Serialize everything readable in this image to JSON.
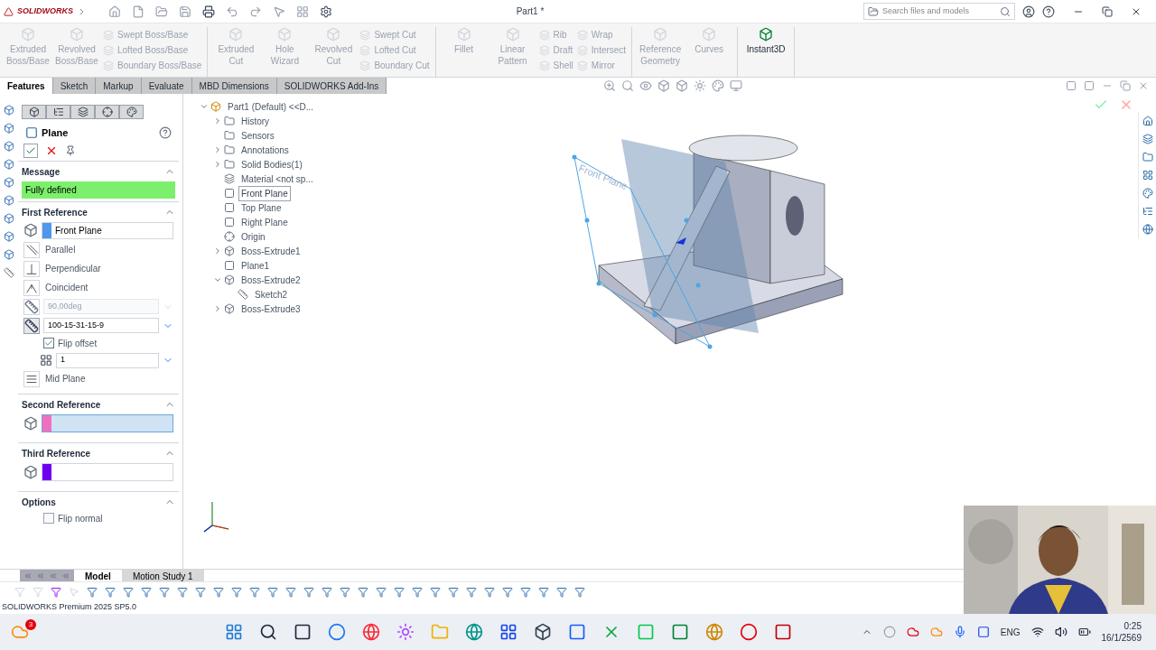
{
  "title_bar": {
    "logo": "SOLIDWORKS",
    "title": "Part1 *",
    "search": {
      "placeholder": "Search files and models"
    }
  },
  "ribbon": {
    "groups": [
      {
        "columns": [
          {
            "kind": "large",
            "items": [
              {
                "label": "Extruded Boss/Base",
                "disabled": true
              }
            ]
          },
          {
            "kind": "large",
            "items": [
              {
                "label": "Revolved Boss/Base",
                "disabled": true
              }
            ]
          },
          {
            "kind": "stack",
            "items": [
              {
                "label": "Swept Boss/Base",
                "disabled": true
              },
              {
                "label": "Lofted Boss/Base",
                "disabled": true
              },
              {
                "label": "Boundary Boss/Base",
                "disabled": true
              }
            ]
          }
        ]
      },
      {
        "columns": [
          {
            "kind": "large",
            "items": [
              {
                "label": "Extruded Cut",
                "disabled": true
              }
            ]
          },
          {
            "kind": "large",
            "items": [
              {
                "label": "Hole Wizard",
                "disabled": true
              }
            ]
          },
          {
            "kind": "large",
            "items": [
              {
                "label": "Revolved Cut",
                "disabled": true
              }
            ]
          },
          {
            "kind": "stack",
            "items": [
              {
                "label": "Swept Cut",
                "disabled": true
              },
              {
                "label": "Lofted Cut",
                "disabled": true
              },
              {
                "label": "Boundary Cut",
                "disabled": true
              }
            ]
          }
        ]
      },
      {
        "columns": [
          {
            "kind": "large",
            "items": [
              {
                "label": "Fillet",
                "disabled": true
              }
            ]
          },
          {
            "kind": "large",
            "items": [
              {
                "label": "Linear Pattern",
                "disabled": true
              }
            ]
          },
          {
            "kind": "stack",
            "items": [
              {
                "label": "Rib",
                "disabled": true
              },
              {
                "label": "Draft",
                "disabled": true
              },
              {
                "label": "Shell",
                "disabled": true
              }
            ]
          },
          {
            "kind": "stack",
            "items": [
              {
                "label": "Wrap",
                "disabled": true
              },
              {
                "label": "Intersect",
                "disabled": true
              },
              {
                "label": "Mirror",
                "disabled": true
              }
            ]
          }
        ]
      },
      {
        "columns": [
          {
            "kind": "large",
            "items": [
              {
                "label": "Reference Geometry",
                "disabled": true
              }
            ]
          },
          {
            "kind": "large",
            "items": [
              {
                "label": "Curves",
                "disabled": true
              }
            ]
          }
        ]
      },
      {
        "columns": [
          {
            "kind": "large",
            "items": [
              {
                "label": "Instant3D",
                "disabled": false
              }
            ]
          }
        ]
      }
    ]
  },
  "command_tabs": [
    {
      "label": "Features",
      "selected": true
    },
    {
      "label": "Sketch",
      "selected": false
    },
    {
      "label": "Markup",
      "selected": false
    },
    {
      "label": "Evaluate",
      "selected": false
    },
    {
      "label": "MBD Dimensions",
      "selected": false
    },
    {
      "label": "SOLIDWORKS Add-Ins",
      "selected": false
    }
  ],
  "property_manager": {
    "title": "Plane",
    "message": {
      "title": "Message",
      "text": "Fully defined"
    },
    "first_reference": {
      "title": "First Reference",
      "value": "Front Plane",
      "color": "#4f97ee",
      "constraints": [
        {
          "kind": "parallel",
          "label": "Parallel"
        },
        {
          "kind": "perpendicular",
          "label": "Perpendicular"
        },
        {
          "kind": "coincident",
          "label": "Coincident"
        }
      ],
      "angle": {
        "value": "90,00deg",
        "disabled": true
      },
      "offset": {
        "value": "100-15-31-15-9"
      },
      "flip_offset": {
        "label": "Flip offset",
        "checked": true
      },
      "count": {
        "value": "1"
      },
      "mid_plane": "Mid Plane"
    },
    "second_reference": {
      "title": "Second Reference",
      "color": "#f070c0",
      "active": true
    },
    "third_reference": {
      "title": "Third Reference",
      "color": "#7000f0",
      "active": false
    },
    "options": {
      "title": "Options",
      "flip_normal": {
        "label": "Flip normal",
        "checked": false
      }
    }
  },
  "feature_tree": [
    {
      "label": "Part1 (Default) <<D...",
      "kind": "part",
      "expanded": true,
      "selected": false,
      "children": [
        {
          "label": "History",
          "kind": "folder",
          "expanded": false,
          "selected": false
        },
        {
          "label": "Sensors",
          "kind": "folder",
          "selected": false
        },
        {
          "label": "Annotations",
          "kind": "folder",
          "expanded": false,
          "selected": false
        },
        {
          "label": "Solid Bodies(1)",
          "kind": "folder",
          "expanded": false,
          "selected": false
        },
        {
          "label": "Material <not sp...",
          "kind": "material",
          "selected": false
        },
        {
          "label": "Front Plane",
          "kind": "plane",
          "selected": true
        },
        {
          "label": "Top Plane",
          "kind": "plane",
          "selected": false
        },
        {
          "label": "Right Plane",
          "kind": "plane",
          "selected": false
        },
        {
          "label": "Origin",
          "kind": "origin",
          "selected": false
        },
        {
          "label": "Boss-Extrude1",
          "kind": "feature",
          "expanded": false,
          "selected": false
        },
        {
          "label": "Plane1",
          "kind": "plane",
          "selected": false
        },
        {
          "label": "Boss-Extrude2",
          "kind": "feature",
          "expanded": true,
          "selected": false,
          "children": [
            {
              "label": "Sketch2",
              "kind": "sketch",
              "selected": false
            }
          ]
        },
        {
          "label": "Boss-Extrude3",
          "kind": "feature",
          "expanded": false,
          "selected": false
        }
      ]
    }
  ],
  "graphics": {
    "plane_label": "Front Plane"
  },
  "model_tabs": [
    {
      "label": "Model",
      "selected": true
    },
    {
      "label": "Motion Study 1",
      "selected": false
    }
  ],
  "status_bar": "SOLIDWORKS Premium 2025 SP5.0",
  "taskbar": {
    "badge": "3",
    "language": "ENG",
    "time": "0:25",
    "date": "16/1/2569"
  }
}
